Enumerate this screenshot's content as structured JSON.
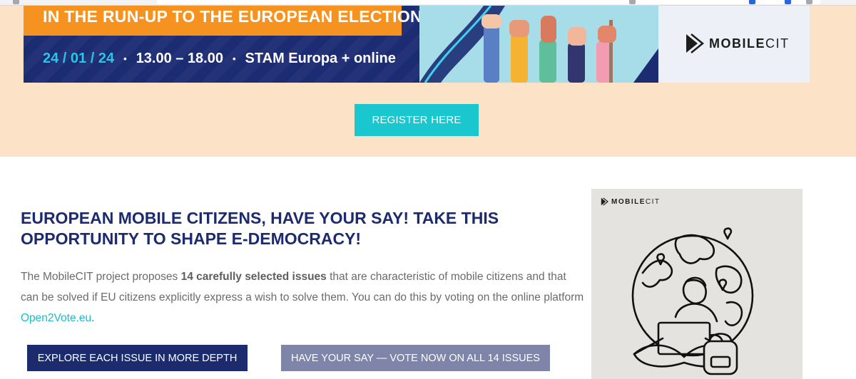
{
  "banner": {
    "title": "IN THE RUN-UP TO THE EUROPEAN ELECTIONS",
    "date": "24 / 01 / 24",
    "separator": "•",
    "time": "13.00 – 18.00",
    "venue": "STAM Europa + online",
    "logo_main": "MOBILE",
    "logo_suffix": "CIT",
    "icon": "play-logo-icon"
  },
  "hero": {
    "register_label": "REGISTER HERE"
  },
  "main": {
    "heading": "EUROPEAN MOBILE CITIZENS, HAVE YOUR SAY! TAKE THIS OPPORTUNITY TO SHAPE E-DEMOCRACY!",
    "body_part1": "The MobileCIT project proposes ",
    "body_bold": "14 carefully selected issues",
    "body_part2": " that are characteristic of mobile citizens and that can be solved if EU citizens explicitly express a wish to solve them. You can do this by voting on the online platform ",
    "body_link": "Open2Vote.eu",
    "body_end": ".",
    "explore_label": "EXPLORE EACH ISSUE IN MORE DEPTH",
    "vote_label": "HAVE YOUR SAY — VOTE NOW ON ALL 14 ISSUES"
  },
  "side_card": {
    "logo_main": "MOBILE",
    "logo_suffix": "CIT",
    "illustration": "globe-person-laptop-illustration"
  },
  "colors": {
    "navy": "#1b2b6e",
    "orange": "#f59220",
    "teal": "#1bc7cf",
    "peach": "#fce3c8",
    "grey_button": "#7f85a9"
  }
}
